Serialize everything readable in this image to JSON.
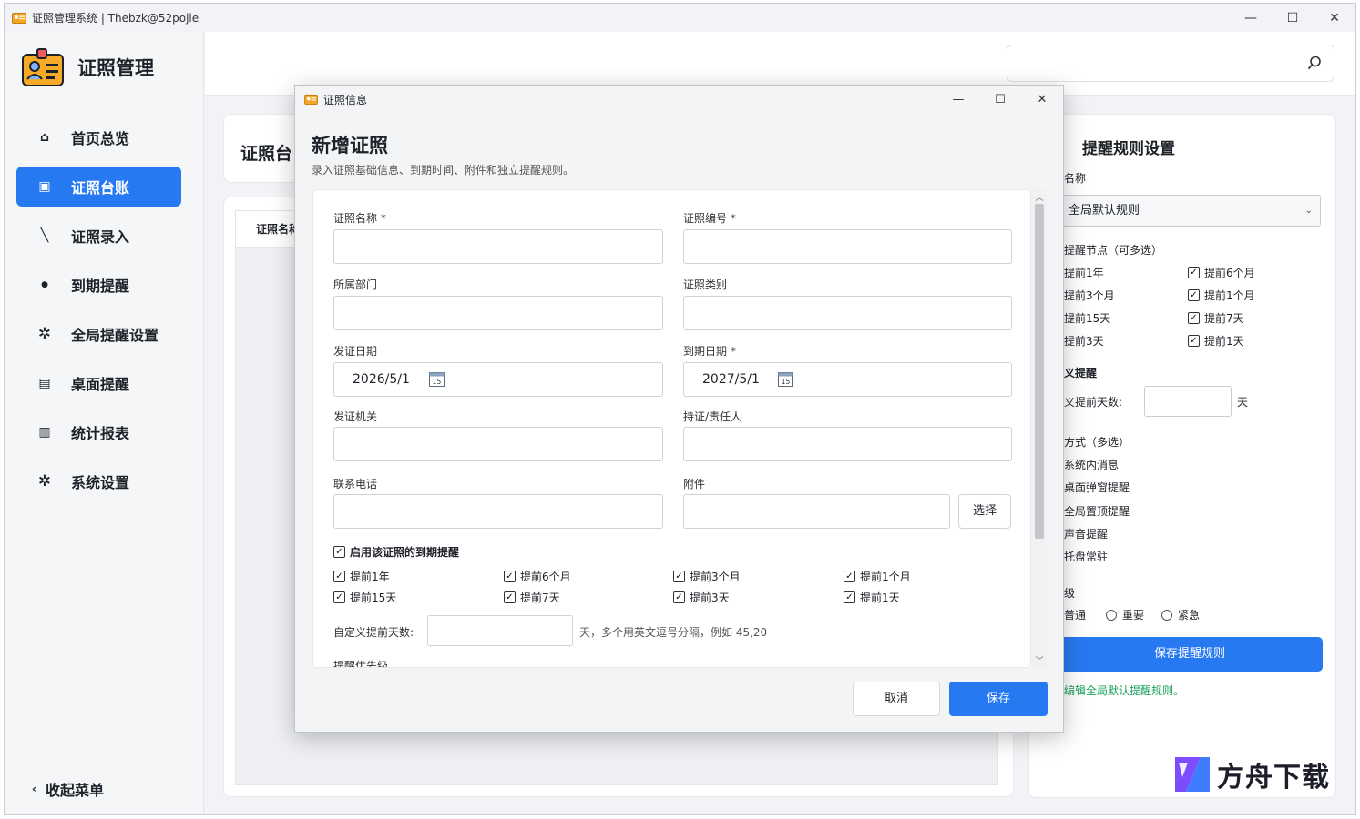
{
  "window": {
    "title": "证照管理系统 | Thebzk@52pojie"
  },
  "sidebar": {
    "brand": "证照管理",
    "items": [
      {
        "label": "首页总览",
        "icon": "home-icon",
        "glyph": "⌂",
        "active": false
      },
      {
        "label": "证照台账",
        "icon": "ledger-icon",
        "glyph": "▣",
        "active": true
      },
      {
        "label": "证照录入",
        "icon": "pen-icon",
        "glyph": "╲",
        "active": false
      },
      {
        "label": "到期提醒",
        "icon": "dot-icon",
        "glyph": "●",
        "active": false
      },
      {
        "label": "全局提醒设置",
        "icon": "gear-icon",
        "glyph": "✲",
        "active": false
      },
      {
        "label": "桌面提醒",
        "icon": "list-icon",
        "glyph": "▤",
        "active": false
      },
      {
        "label": "统计报表",
        "icon": "chart-icon",
        "glyph": "▥",
        "active": false
      },
      {
        "label": "系统设置",
        "icon": "gear-icon",
        "glyph": "✲",
        "active": false
      }
    ],
    "collapse": "收起菜单"
  },
  "main": {
    "card_title": "证照台",
    "table_header": "证照名称"
  },
  "right_panel": {
    "title": "提醒规则设置",
    "rule_name_label": "名称",
    "rule_select_value": "全局默认规则",
    "nodes_label": "提醒节点（可多选）",
    "nodes": [
      {
        "label": "提前1年",
        "checked": false
      },
      {
        "label": "提前6个月",
        "checked": true
      },
      {
        "label": "提前3个月",
        "checked": false
      },
      {
        "label": "提前1个月",
        "checked": true
      },
      {
        "label": "提前15天",
        "checked": false
      },
      {
        "label": "提前7天",
        "checked": true
      },
      {
        "label": "提前3天",
        "checked": false
      },
      {
        "label": "提前1天",
        "checked": true
      }
    ],
    "custom_title": "义提醒",
    "custom_label": "义提前天数:",
    "custom_unit": "天",
    "methods_label": "方式（多选）",
    "methods": [
      "系统内消息",
      "桌面弹窗提醒",
      "全局置顶提醒",
      "声音提醒",
      "托盘常驻"
    ],
    "priority_label": "级",
    "priorities": [
      "普通",
      "重要",
      "紧急"
    ],
    "save_button": "保存提醒规则",
    "hint": "编辑全局默认提醒规则。"
  },
  "dialog": {
    "title": "证照信息",
    "heading": "新增证照",
    "subtitle": "录入证照基础信息、到期时间、附件和独立提醒规则。",
    "fields": {
      "name_label": "证照名称 *",
      "number_label": "证照编号 *",
      "dept_label": "所属部门",
      "category_label": "证照类别",
      "issue_date_label": "发证日期",
      "issue_date_value": "2026/5/1",
      "expire_date_label": "到期日期 *",
      "expire_date_value": "2027/5/1",
      "authority_label": "发证机关",
      "holder_label": "持证/责任人",
      "phone_label": "联系电话",
      "attachment_label": "附件",
      "choose_button": "选择",
      "enable_reminder": "启用该证照的到期提醒",
      "custom_days_label": "自定义提前天数:",
      "custom_days_hint": "天，多个用英文逗号分隔，例如 45,20",
      "priority_label": "提醒优先级"
    },
    "reminders": [
      "提前1年",
      "提前6个月",
      "提前3个月",
      "提前1个月",
      "提前15天",
      "提前7天",
      "提前3天",
      "提前1天"
    ],
    "cancel": "取消",
    "save": "保存"
  },
  "watermark": "方舟下载",
  "colors": {
    "accent": "#2779f2",
    "hint_green": "#1aa05c"
  }
}
